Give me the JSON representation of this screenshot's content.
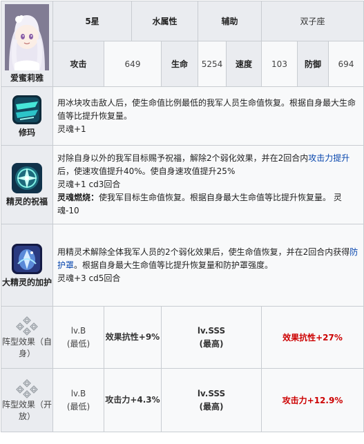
{
  "character": {
    "name": "爱蜜莉雅",
    "rarity": "5星",
    "element": "水属性",
    "role": "辅助",
    "constellation": "双子座"
  },
  "stats": [
    {
      "label": "攻击",
      "value": "649"
    },
    {
      "label": "生命",
      "value": "5254"
    },
    {
      "label": "速度",
      "value": "103"
    },
    {
      "label": "防御",
      "value": "694"
    }
  ],
  "skills": [
    {
      "name": "修玛",
      "icon": "ice-crystal-skill-icon",
      "desc_parts": [
        "用冰块攻击敌人后，使生命值比例最低的我军人员生命值恢复。根据自身最大生命值等比提升恢复量。"
      ],
      "soul": "灵魂+1"
    },
    {
      "name": "精灵的祝福",
      "icon": "spirit-blessing-skill-icon",
      "desc_before": "对除自身以外的我军目标赐予祝福，解除2个弱化效果，并在2回合内",
      "desc_link": "攻击力提升",
      "desc_after": "后，使速攻值提升40%。使自身速攻值提升25%",
      "soul": "灵魂+1 cd3回合",
      "burn_label": "灵魂燃烧：",
      "burn_text": "使我军目标生命值恢复。根据自身最大生命值等比提升恢复量。 灵魂-10"
    },
    {
      "name": "大精灵的加护",
      "icon": "great-spirit-protection-skill-icon",
      "desc_before": "用精灵术解除全体我军人员的2个弱化效果后，使生命值恢复，并在2回合内获得",
      "desc_link": "防护罩",
      "desc_after": "。根据自身最大生命值等比提升恢复量和防护罩强度。",
      "soul": "灵魂+3 cd5回合"
    }
  ],
  "formations": [
    {
      "label": "阵型效果（自身）",
      "icon": "formation-icon",
      "low_level": "lv.B",
      "low_caption": "(最低)",
      "low_effect": "效果抗性+9%",
      "high_level": "lv.SSS",
      "high_caption": "(最高)",
      "high_effect": "效果抗性+27%"
    },
    {
      "label": "阵型效果（开放）",
      "icon": "formation-icon",
      "low_level": "lv.B",
      "low_caption": "(最低)",
      "low_effect": "攻击力+4.3%",
      "high_level": "lv.SSS",
      "high_caption": "(最高)",
      "high_effect": "攻击力+12.9%"
    }
  ],
  "colors": {
    "header_bg": "#eaecf0",
    "cell_bg": "#f8f9fa",
    "border": "#c8ccd1",
    "link": "#0645ad",
    "highlight_red": "#cc0000"
  }
}
